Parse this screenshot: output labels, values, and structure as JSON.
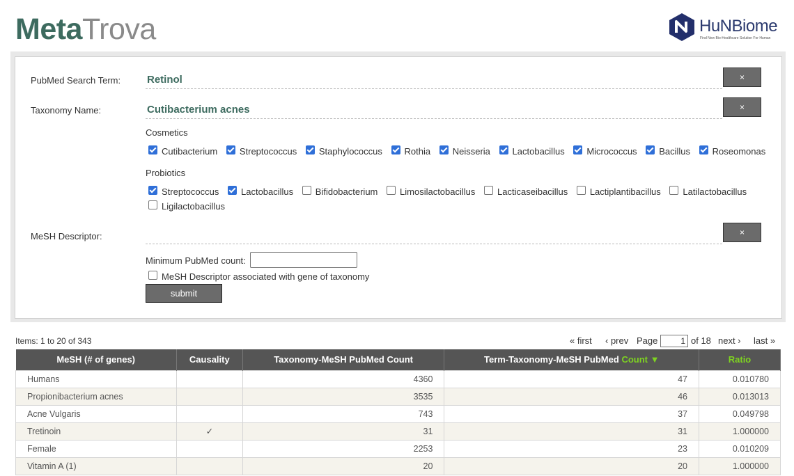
{
  "header": {
    "logo_meta": "Meta",
    "logo_trova": "Trova",
    "brand_name": "HuNBiome",
    "brand_tagline": "Find New Bio-Healthcare Solution For Human"
  },
  "form": {
    "pubmed_label": "PubMed Search Term:",
    "pubmed_value": "Retinol",
    "taxonomy_label": "Taxonomy Name:",
    "taxonomy_value": "Cutibacterium acnes",
    "clear_label": "×",
    "cosmetics_label": "Cosmetics",
    "cosmetics": [
      {
        "label": "Cutibacterium",
        "checked": true
      },
      {
        "label": "Streptococcus",
        "checked": true
      },
      {
        "label": "Staphylococcus",
        "checked": true
      },
      {
        "label": "Rothia",
        "checked": true
      },
      {
        "label": "Neisseria",
        "checked": true
      },
      {
        "label": "Lactobacillus",
        "checked": true
      },
      {
        "label": "Micrococcus",
        "checked": true
      },
      {
        "label": "Bacillus",
        "checked": true
      },
      {
        "label": "Roseomonas",
        "checked": true
      }
    ],
    "probiotics_label": "Probiotics",
    "probiotics": [
      {
        "label": "Streptococcus",
        "checked": true
      },
      {
        "label": "Lactobacillus",
        "checked": true
      },
      {
        "label": "Bifidobacterium",
        "checked": false
      },
      {
        "label": "Limosilactobacillus",
        "checked": false
      },
      {
        "label": "Lacticaseibacillus",
        "checked": false
      },
      {
        "label": "Lactiplantibacillus",
        "checked": false
      },
      {
        "label": "Latilactobacillus",
        "checked": false
      },
      {
        "label": "Ligilactobacillus",
        "checked": false
      }
    ],
    "mesh_label": "MeSH Descriptor:",
    "min_count_label": "Minimum PubMed count:",
    "min_count_value": "",
    "gene_assoc_label": "MeSH Descriptor associated with gene of taxonomy",
    "gene_assoc_checked": false,
    "submit_label": "submit"
  },
  "results": {
    "items_text": "Items: 1 to 20 of 343",
    "pager": {
      "first": "« first",
      "prev": "‹ prev",
      "page_label": "Page",
      "page_value": "1",
      "of_label": "of 18",
      "next": "next ›",
      "last": "last »"
    },
    "columns": {
      "mesh": "MeSH (# of genes)",
      "causality": "Causality",
      "tax_count": "Taxonomy-MeSH PubMed Count",
      "term_count_prefix": "Term-Taxonomy-MeSH PubMed",
      "term_count_suffix": "Count ▼",
      "ratio": "Ratio"
    },
    "rows": [
      {
        "mesh": "Humans",
        "causality": "",
        "tax_count": "4360",
        "term_count": "47",
        "ratio": "0.010780"
      },
      {
        "mesh": "Propionibacterium acnes",
        "causality": "",
        "tax_count": "3535",
        "term_count": "46",
        "ratio": "0.013013"
      },
      {
        "mesh": "Acne Vulgaris",
        "causality": "",
        "tax_count": "743",
        "term_count": "37",
        "ratio": "0.049798"
      },
      {
        "mesh": "Tretinoin",
        "causality": "✓",
        "tax_count": "31",
        "term_count": "31",
        "ratio": "1.000000"
      },
      {
        "mesh": "Female",
        "causality": "",
        "tax_count": "2253",
        "term_count": "23",
        "ratio": "0.010209"
      },
      {
        "mesh": "Vitamin A (1)",
        "causality": "",
        "tax_count": "20",
        "term_count": "20",
        "ratio": "1.000000"
      }
    ]
  }
}
